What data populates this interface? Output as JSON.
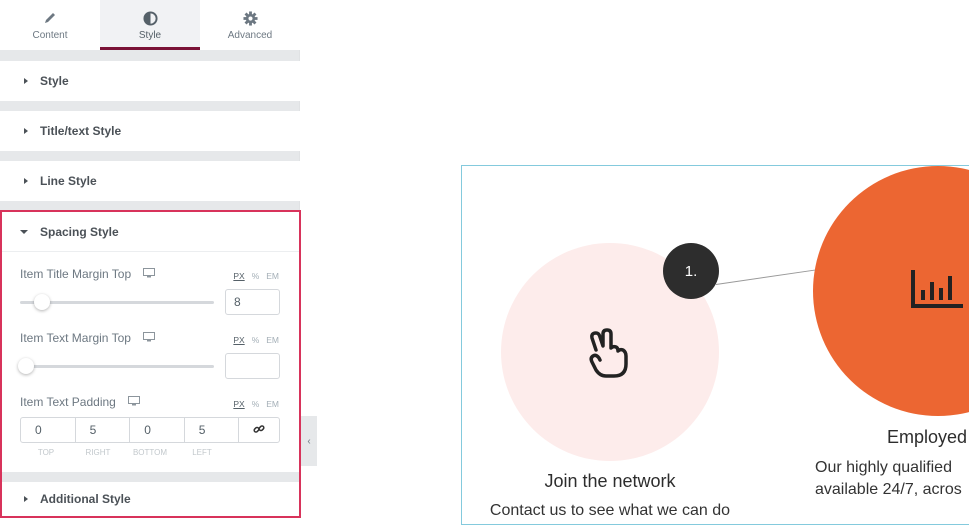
{
  "panel": {
    "tabs": [
      {
        "label": "Content",
        "icon": "pencil-icon",
        "active": false
      },
      {
        "label": "Style",
        "icon": "half-circle-icon",
        "active": true
      },
      {
        "label": "Advanced",
        "icon": "gear-icon",
        "active": false
      }
    ],
    "sections": [
      {
        "label": "Style"
      },
      {
        "label": "Title/text Style"
      },
      {
        "label": "Line Style"
      }
    ],
    "spacing": {
      "label": "Spacing Style",
      "controls": {
        "title_margin": {
          "label": "Item Title Margin Top",
          "value": "8",
          "slider_fraction": 0.08,
          "units": [
            "PX",
            "%",
            "EM"
          ],
          "active_unit": "PX"
        },
        "text_margin": {
          "label": "Item Text Margin Top",
          "value": "",
          "slider_fraction": 0,
          "units": [
            "PX",
            "%",
            "EM"
          ],
          "active_unit": "PX"
        },
        "text_padding": {
          "label": "Item Text Padding",
          "units": [
            "PX",
            "%",
            "EM"
          ],
          "active_unit": "PX",
          "values": {
            "top": "0",
            "right": "5",
            "bottom": "0",
            "left": "5"
          },
          "labels": {
            "top": "TOP",
            "right": "RIGHT",
            "bottom": "BOTTOM",
            "left": "LEFT"
          }
        }
      }
    },
    "additional": {
      "label": "Additional Style"
    },
    "highlight_color": "#d8335b",
    "active_tab_color": "#7a1236"
  },
  "canvas": {
    "step_badge": "1.",
    "item1": {
      "title": "Join the network",
      "text": "Contact us to see what we can do"
    },
    "item2": {
      "title": "Employed",
      "text_lines": [
        "Our highly qualified",
        "available 24/7, acros"
      ]
    },
    "colors": {
      "pink": "#fdeceb",
      "orange": "#ec6632",
      "badge": "#2d2d2d",
      "frame": "#84cadd"
    }
  }
}
